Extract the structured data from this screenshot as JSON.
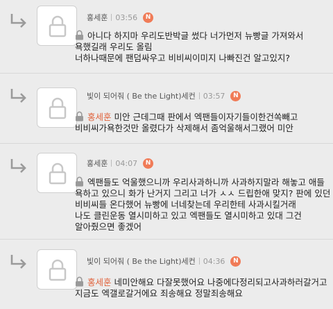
{
  "comments": [
    {
      "author": "홍세훈",
      "time": "03:56",
      "badge": "N",
      "mention": "",
      "lines": [
        "아니다 하지마 우리도반박글 썼다 너가먼저 뉴빵글 가져와서",
        "욕했길래 우리도 올림",
        "너하나때문에 팬덤싸우고 비비씨이미지 나빠진건 알고있지?"
      ]
    },
    {
      "author": "빛이 되어줘 ( Be the Light)세컨",
      "time": "03:57",
      "badge": "N",
      "mention": "홍세훈",
      "lines": [
        "미안 근데그때 판에서 엑팬들이자기들이한건쏙빼고",
        "비비씨가욕한것만 올렸다가 삭제해서 좀억울해서그랬어 미안"
      ]
    },
    {
      "author": "홍세훈",
      "time": "04:07",
      "badge": "N",
      "mention": "",
      "lines": [
        "엑팬들도 억울했으니까 우리사과하니까 사과하지말라 해놓고 애들",
        "욕하고 있으니 화가 난거지 그리고 너가 ㅅㅅ 드립한애 맞지? 판에 있던",
        "비비씨들 온다했어 뉴빵에 너네찾는데 우리한테 사과시킬거래",
        "나도 클린운동 열시미하고 있고 엑팬들도 열시미하고 있대 그건",
        "알아줬으면 좋겠어"
      ]
    },
    {
      "author": "빛이 되어줘 ( Be the Light)세컨",
      "time": "04:36",
      "badge": "N",
      "mention": "홍세훈",
      "lines": [
        "네미안해요 다잘못했어요 나중에다정리되고사과하러갈거고",
        "지금도 엑갤로갈거에요 죄송해요 정말죄송해요"
      ]
    }
  ]
}
